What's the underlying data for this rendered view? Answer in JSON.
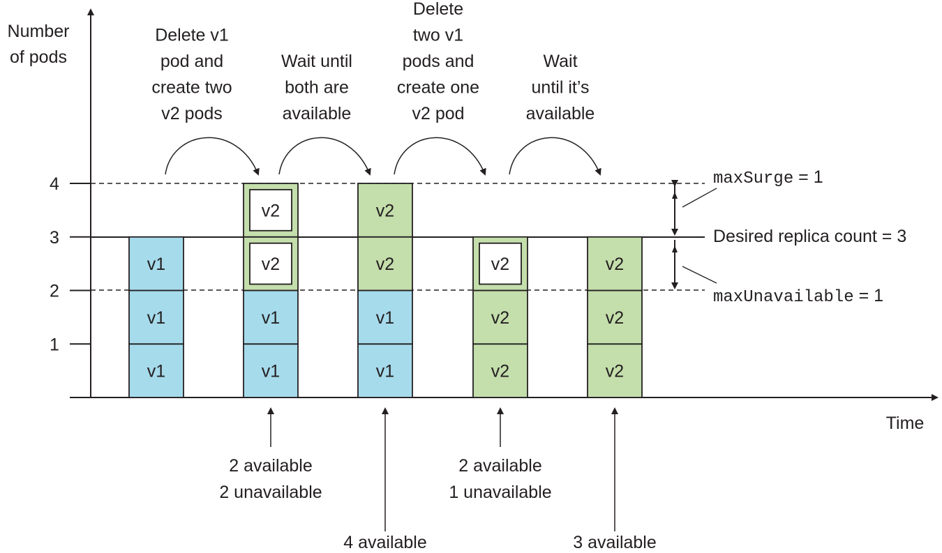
{
  "y_axis": {
    "label": [
      "Number",
      "of pods"
    ],
    "ticks": [
      "1",
      "2",
      "3",
      "4"
    ]
  },
  "x_axis": {
    "label": "Time"
  },
  "colors": {
    "v1": "#a6dbec",
    "v2": "#c4deac",
    "outline": "#231f20"
  },
  "steps": [
    {
      "lines": [
        "Delete v1",
        "pod and",
        "create two",
        "v2 pods"
      ]
    },
    {
      "lines": [
        "Wait until",
        "both are",
        "available"
      ]
    },
    {
      "lines": [
        "Delete",
        "two v1",
        "pods and",
        "create one",
        "v2 pod"
      ]
    },
    {
      "lines": [
        "Wait",
        "until it’s",
        "available"
      ]
    }
  ],
  "columns": [
    {
      "pods": [
        {
          "label": "v1",
          "version": "v1",
          "available": true
        },
        {
          "label": "v1",
          "version": "v1",
          "available": true
        },
        {
          "label": "v1",
          "version": "v1",
          "available": true
        }
      ]
    },
    {
      "pods": [
        {
          "label": "v1",
          "version": "v1",
          "available": true
        },
        {
          "label": "v1",
          "version": "v1",
          "available": true
        },
        {
          "label": "v2",
          "version": "v2",
          "available": false
        },
        {
          "label": "v2",
          "version": "v2",
          "available": false
        }
      ],
      "status": [
        "2 available",
        "2 unavailable"
      ]
    },
    {
      "pods": [
        {
          "label": "v1",
          "version": "v1",
          "available": true
        },
        {
          "label": "v1",
          "version": "v1",
          "available": true
        },
        {
          "label": "v2",
          "version": "v2",
          "available": true
        },
        {
          "label": "v2",
          "version": "v2",
          "available": true
        }
      ],
      "status": [
        "4 available"
      ]
    },
    {
      "pods": [
        {
          "label": "v2",
          "version": "v2",
          "available": true
        },
        {
          "label": "v2",
          "version": "v2",
          "available": true
        },
        {
          "label": "v2",
          "version": "v2",
          "available": false
        }
      ],
      "status": [
        "2 available",
        "1 unavailable"
      ]
    },
    {
      "pods": [
        {
          "label": "v2",
          "version": "v2",
          "available": true
        },
        {
          "label": "v2",
          "version": "v2",
          "available": true
        },
        {
          "label": "v2",
          "version": "v2",
          "available": true
        }
      ],
      "status": [
        "3 available"
      ]
    }
  ],
  "annotations": {
    "max_surge": {
      "code": "maxSurge",
      "value": " = 1"
    },
    "desired": "Desired replica count = 3",
    "max_unavailable": {
      "code": "maxUnavailable",
      "value": " = 1"
    }
  }
}
